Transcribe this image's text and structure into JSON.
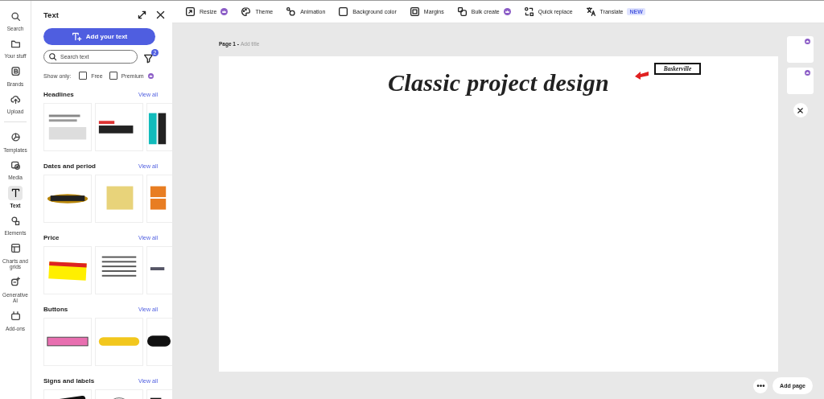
{
  "rail": [
    {
      "label": "Search",
      "selected": false
    },
    {
      "label": "Your stuff",
      "selected": false
    },
    {
      "label": "Brands",
      "selected": false
    },
    {
      "label": "Upload",
      "selected": false
    },
    {
      "label": "Templates",
      "selected": false
    },
    {
      "label": "Media",
      "selected": false
    },
    {
      "label": "Text",
      "selected": true
    },
    {
      "label": "Elements",
      "selected": false
    },
    {
      "label": "Charts and grids",
      "selected": false
    },
    {
      "label": "Generative AI",
      "selected": false
    },
    {
      "label": "Add-ons",
      "selected": false
    }
  ],
  "panel": {
    "title": "Text",
    "add_button": "Add your text",
    "search": {
      "placeholder": "Search text"
    },
    "filter_badge": "2",
    "show_only": {
      "label": "Show only:",
      "options": [
        {
          "label": "Free",
          "checked": false,
          "premium": false
        },
        {
          "label": "Premium",
          "checked": false,
          "premium": true
        }
      ]
    },
    "sections": [
      {
        "title": "Headlines",
        "link": "View all"
      },
      {
        "title": "Dates and period",
        "link": "View all"
      },
      {
        "title": "Price",
        "link": "View all"
      },
      {
        "title": "Buttons",
        "link": "View all"
      },
      {
        "title": "Signs and labels",
        "link": "View all"
      }
    ]
  },
  "toolbar": [
    {
      "label": "Resize",
      "premium": true
    },
    {
      "label": "Theme",
      "premium": false
    },
    {
      "label": "Animation",
      "premium": false
    },
    {
      "label": "Background color",
      "premium": false
    },
    {
      "label": "Margins",
      "premium": false
    },
    {
      "label": "Bulk create",
      "premium": true
    },
    {
      "label": "Quick replace",
      "premium": false
    },
    {
      "label": "Translate",
      "premium": false,
      "tag": "NEW"
    }
  ],
  "page": {
    "label": "Page 1 -",
    "title_placeholder": "Add title",
    "heading": "Classic project design",
    "callout": "Baskerville"
  },
  "page_thumbnails": [
    {
      "premium": true
    },
    {
      "premium": true
    }
  ],
  "footer": {
    "add_page": "Add page"
  }
}
